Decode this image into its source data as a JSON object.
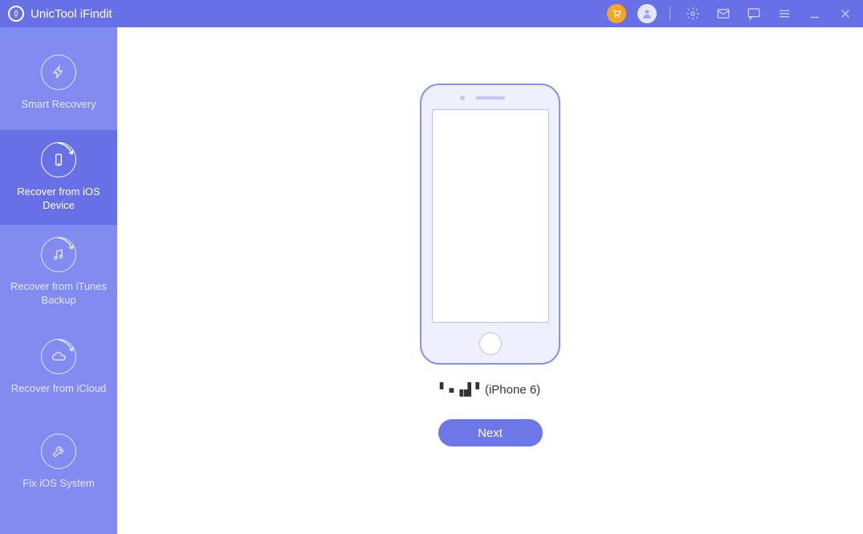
{
  "app": {
    "title": "UnicTool iFindit"
  },
  "sidebar": {
    "items": [
      {
        "label": "Smart Recovery"
      },
      {
        "label": "Recover from iOS Device"
      },
      {
        "label": "Recover from iTunes Backup"
      },
      {
        "label": "Recover from iCloud"
      },
      {
        "label": "Fix iOS System"
      }
    ]
  },
  "main": {
    "device_name_obscured": "▘▪▗▟▝",
    "device_model": "(iPhone 6)",
    "next_label": "Next"
  }
}
